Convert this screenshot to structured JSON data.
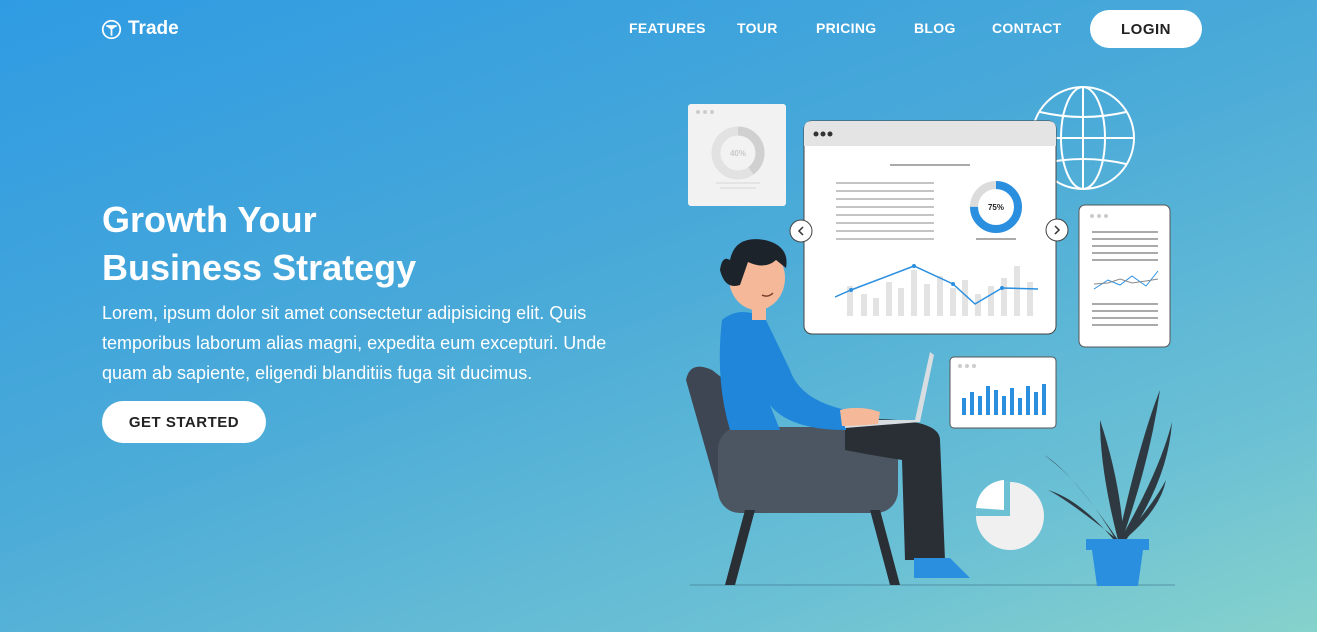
{
  "brand": {
    "name": "Trade",
    "icon": "trade-logo-icon"
  },
  "nav": {
    "items": [
      {
        "label": "FEATURES"
      },
      {
        "label": "TOUR"
      },
      {
        "label": "PRICING"
      },
      {
        "label": "BLOG"
      },
      {
        "label": "CONTACT"
      }
    ],
    "login_label": "LOGIN"
  },
  "hero": {
    "title_line1": "Growth Your",
    "title_line2": "Business Strategy",
    "description": "Lorem, ipsum dolor sit amet consectetur adipisicing elit. Quis temporibus laborum alias magni, expedita eum excepturi. Unde quam ab sapiente, eligendi blanditiis fuga sit ducimus.",
    "cta_label": "GET STARTED"
  },
  "illustration": {
    "small_card_percent": "40%",
    "main_card_percent": "75%",
    "main_card_progress": 0.75,
    "small_card_progress": 0.4,
    "colors": {
      "accent": "#2b8fe0",
      "chair": "#3d4652",
      "plant": "#2f3942"
    }
  }
}
